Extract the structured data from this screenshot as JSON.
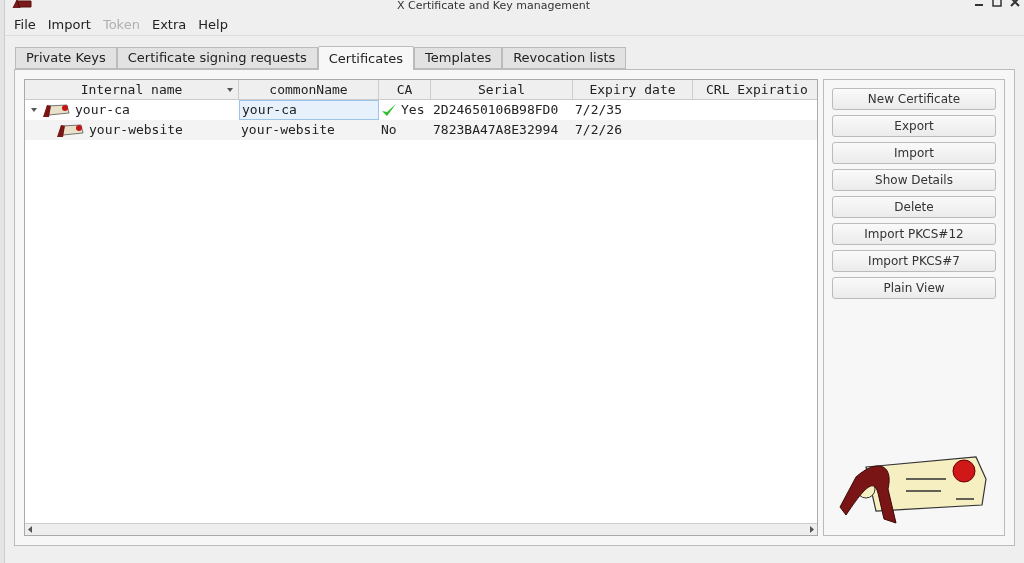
{
  "window": {
    "title": "X Certificate and Key management"
  },
  "menu": [
    {
      "label": "File",
      "disabled": false
    },
    {
      "label": "Import",
      "disabled": false
    },
    {
      "label": "Token",
      "disabled": true
    },
    {
      "label": "Extra",
      "disabled": false
    },
    {
      "label": "Help",
      "disabled": false
    }
  ],
  "tabs": [
    {
      "label": "Private Keys",
      "selected": false
    },
    {
      "label": "Certificate signing requests",
      "selected": false
    },
    {
      "label": "Certificates",
      "selected": true
    },
    {
      "label": "Templates",
      "selected": false
    },
    {
      "label": "Revocation lists",
      "selected": false
    }
  ],
  "table": {
    "columns": [
      "Internal name",
      "commonName",
      "CA",
      "Serial",
      "Expiry date",
      "CRL Expiratio"
    ],
    "rows": [
      {
        "name": "your-ca",
        "common_name": "your-ca",
        "ca": "Yes",
        "ca_checked": true,
        "serial": "2D24650106B98FD0",
        "expiry": "7/2/35",
        "expanded": true,
        "focused": true,
        "children": [
          {
            "name": "your-website",
            "common_name": "your-website",
            "ca": "No",
            "ca_checked": false,
            "serial": "7823BA47A8E32994",
            "expiry": "7/2/26",
            "focused": false
          }
        ]
      }
    ]
  },
  "buttons": [
    "New Certificate",
    "Export",
    "Import",
    "Show Details",
    "Delete",
    "Import PKCS#12",
    "Import PKCS#7",
    "Plain View"
  ]
}
